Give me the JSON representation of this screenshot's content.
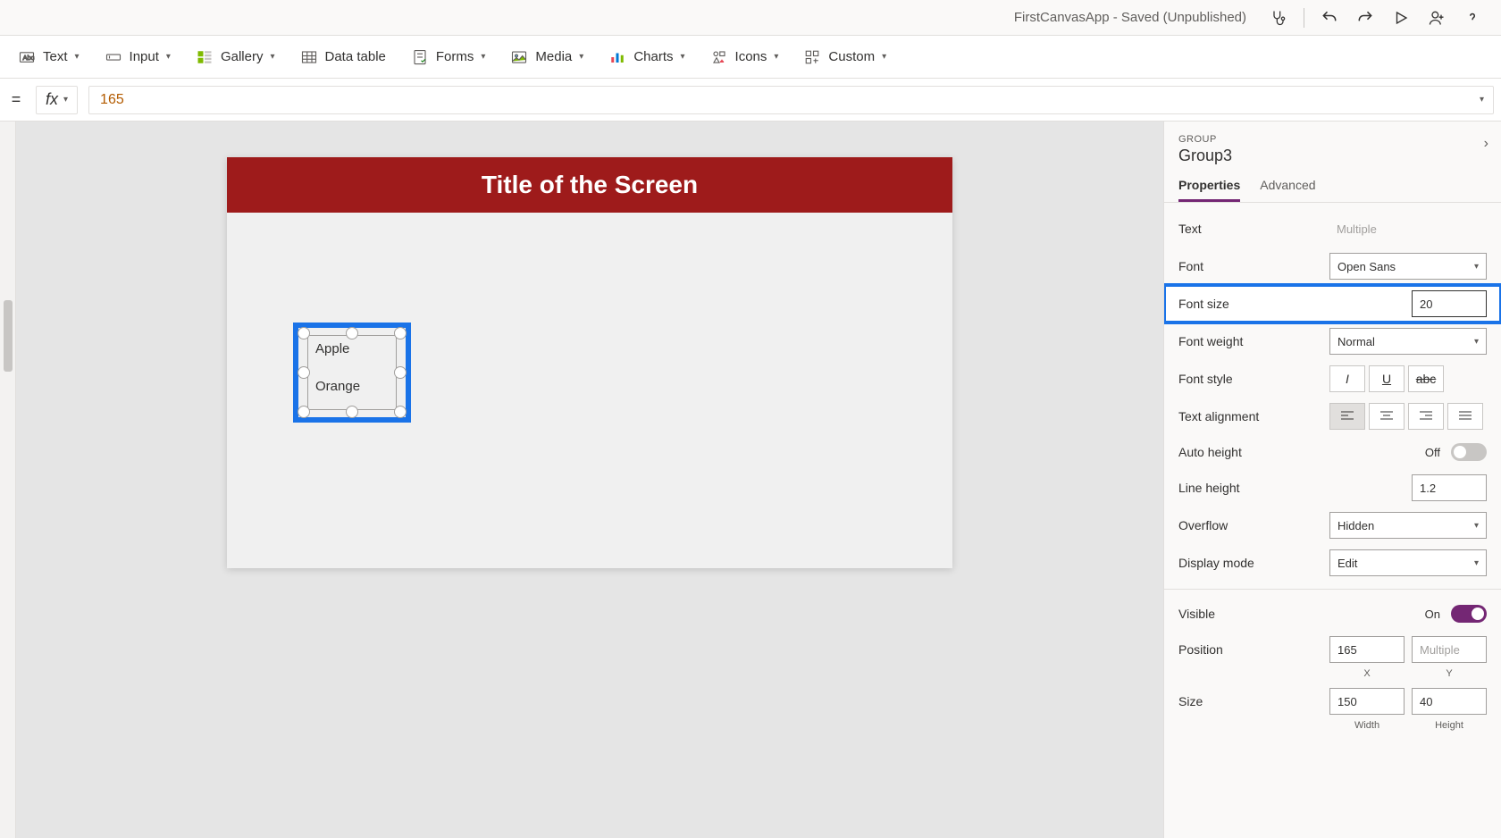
{
  "titlebar": {
    "app_title": "FirstCanvasApp - Saved (Unpublished)"
  },
  "ribbon": {
    "text": "Text",
    "input": "Input",
    "gallery": "Gallery",
    "data_table": "Data table",
    "forms": "Forms",
    "media": "Media",
    "charts": "Charts",
    "icons": "Icons",
    "custom": "Custom"
  },
  "formula": {
    "fx": "fx",
    "value": "165"
  },
  "canvas": {
    "screen_title": "Title of the Screen",
    "labels": [
      "Apple",
      "Orange"
    ]
  },
  "panel": {
    "type": "GROUP",
    "name": "Group3",
    "tabs": {
      "properties": "Properties",
      "advanced": "Advanced"
    },
    "props": {
      "text_label": "Text",
      "text_value": "Multiple",
      "font_label": "Font",
      "font_value": "Open Sans",
      "font_size_label": "Font size",
      "font_size_value": "20",
      "font_weight_label": "Font weight",
      "font_weight_value": "Normal",
      "font_style_label": "Font style",
      "text_align_label": "Text alignment",
      "auto_height_label": "Auto height",
      "auto_height_value": "Off",
      "line_height_label": "Line height",
      "line_height_value": "1.2",
      "overflow_label": "Overflow",
      "overflow_value": "Hidden",
      "display_mode_label": "Display mode",
      "display_mode_value": "Edit",
      "visible_label": "Visible",
      "visible_value": "On",
      "position_label": "Position",
      "position_x": "165",
      "position_y": "Multiple",
      "pos_x_label": "X",
      "pos_y_label": "Y",
      "size_label": "Size",
      "size_w": "150",
      "size_h": "40",
      "size_w_label": "Width",
      "size_h_label": "Height"
    }
  }
}
